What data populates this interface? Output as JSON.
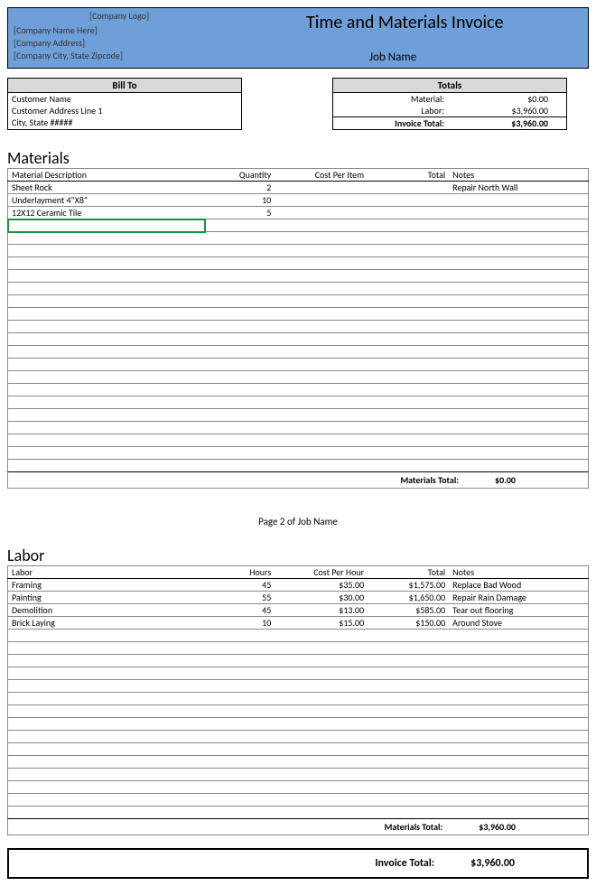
{
  "header": {
    "logo_placeholder": "[Company Logo]",
    "company_name": "[Company Name Here]",
    "company_address": "[Company Address]",
    "company_citystate": "[Company City, State Zipcode]",
    "title": "Time and Materials Invoice",
    "job_name": "Job Name"
  },
  "bill_to": {
    "heading": "Bill To",
    "customer_name": "Customer Name",
    "address1": "Customer Address Line 1",
    "citystate": "City, State #####"
  },
  "totals_box": {
    "heading": "Totals",
    "material_label": "Material:",
    "material_value": "$0.00",
    "labor_label": "Labor:",
    "labor_value": "$3,960.00",
    "invoice_label": "Invoice Total:",
    "invoice_value": "$3,960.00"
  },
  "materials": {
    "section_title": "Materials",
    "cols": {
      "desc": "Material Description",
      "qty": "Quantity",
      "cost": "Cost Per Item",
      "total": "Total",
      "notes": "Notes"
    },
    "rows": [
      {
        "desc": "Sheet Rock",
        "qty": "2",
        "cost": "",
        "total": "",
        "notes": "Repair North Wall"
      },
      {
        "desc": "Underlayment 4\"X8\"",
        "qty": "10",
        "cost": "",
        "total": "",
        "notes": ""
      },
      {
        "desc": "12X12 Ceramic Tile",
        "qty": "5",
        "cost": "",
        "total": "",
        "notes": ""
      }
    ],
    "blank_rows": 20,
    "total_label": "Materials Total:",
    "total_value": "$0.00"
  },
  "page_note": "Page 2 of Job Name",
  "labor": {
    "section_title": "Labor",
    "cols": {
      "desc": "Labor",
      "qty": "Hours",
      "cost": "Cost Per Hour",
      "total": "Total",
      "notes": "Notes"
    },
    "rows": [
      {
        "desc": "Framing",
        "qty": "45",
        "cost": "$35.00",
        "total": "$1,575.00",
        "notes": "Replace Bad Wood"
      },
      {
        "desc": "Painting",
        "qty": "55",
        "cost": "$30.00",
        "total": "$1,650.00",
        "notes": "Repair Rain Damage"
      },
      {
        "desc": "Demolition",
        "qty": "45",
        "cost": "$13.00",
        "total": "$585.00",
        "notes": "Tear out flooring"
      },
      {
        "desc": "Brick Laying",
        "qty": "10",
        "cost": "$15.00",
        "total": "$150.00",
        "notes": "Around Stove"
      }
    ],
    "blank_rows": 15,
    "total_label": "Materials Total:",
    "total_value": "$3,960.00"
  },
  "invoice_total": {
    "label": "Invoice Total:",
    "value": "$3,960.00"
  }
}
